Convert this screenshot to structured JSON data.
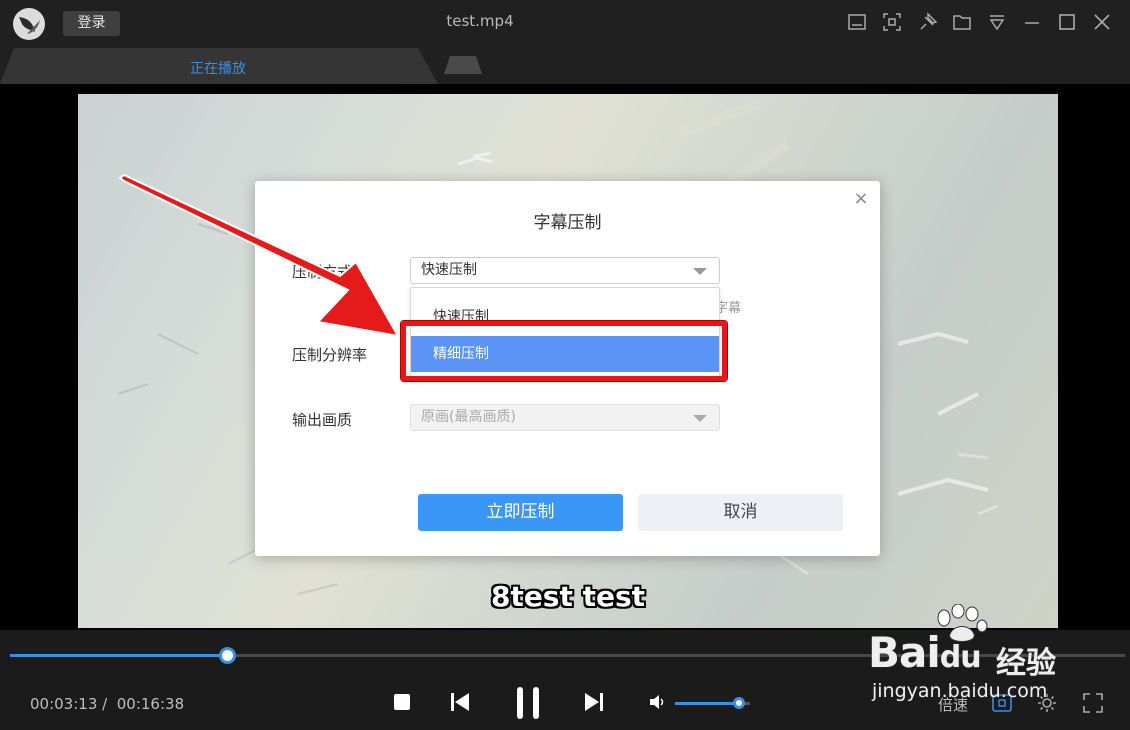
{
  "titlebar": {
    "login_label": "登录",
    "window_title": "test.mp4",
    "icons": [
      "subtitle-icon",
      "screenshot-icon",
      "pin-icon",
      "folder-icon",
      "menu-icon",
      "minimize-icon",
      "maximize-icon",
      "close-icon"
    ]
  },
  "tabs": {
    "active_label": "正在播放"
  },
  "video": {
    "subtitle_text": "8test test"
  },
  "dialog": {
    "title": "字幕压制",
    "method_label": "压制方式",
    "method_value": "快速压制",
    "hint_text": "其字幕",
    "resolution_label": "压制分辨率",
    "quality_label": "输出画质",
    "quality_value": "原画(最高画质)",
    "options": [
      "快速压制",
      "精细压制"
    ],
    "selected_option": "精细压制",
    "confirm_label": "立即压制",
    "cancel_label": "取消"
  },
  "player": {
    "current_time": "00:03:13 /",
    "total_time": "00:16:38",
    "progress_fraction": 0.195,
    "volume_fraction": 0.85,
    "speed_label": "倍速",
    "accent_color": "#3a8ee6"
  },
  "watermark": {
    "brand": "Bai",
    "brand_suffix": "du",
    "cn_text": "经验",
    "url": "jingyan.baidu.com"
  }
}
